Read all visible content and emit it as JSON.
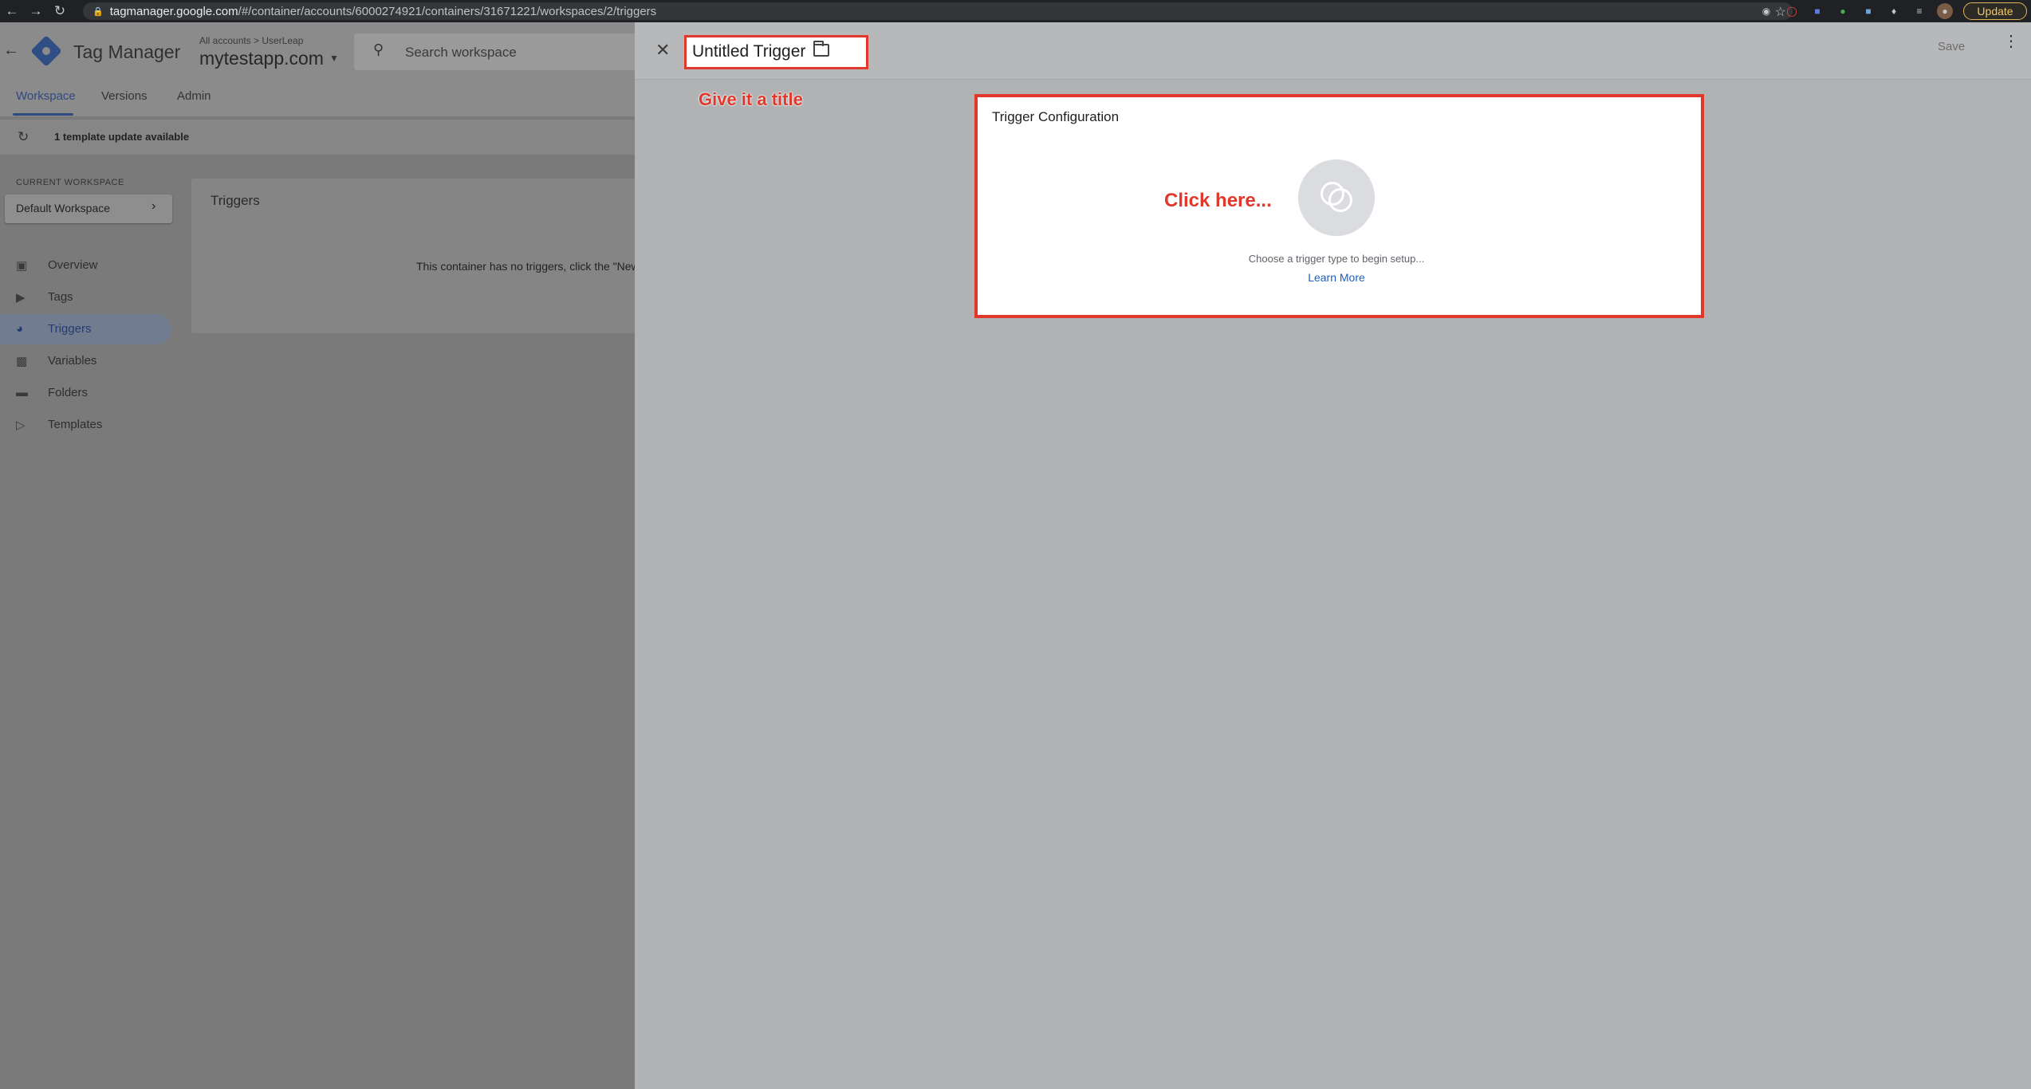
{
  "browser": {
    "url_host": "tagmanager.google.com",
    "url_path": "/#/container/accounts/6000274921/containers/31671221/workspaces/2/triggers",
    "update_label": "Update"
  },
  "app": {
    "product_name": "Tag Manager",
    "breadcrumb": "All accounts  >  UserLeap",
    "container_name": "mytestapp.com",
    "search_placeholder": "Search workspace",
    "tabs": [
      {
        "label": "Workspace"
      },
      {
        "label": "Versions"
      },
      {
        "label": "Admin"
      }
    ],
    "notice": "1 template update available",
    "current_workspace_label": "CURRENT WORKSPACE",
    "workspace_name": "Default Workspace",
    "nav": [
      {
        "label": "Overview",
        "icon": "briefcase-icon"
      },
      {
        "label": "Tags",
        "icon": "tag-icon"
      },
      {
        "label": "Triggers",
        "icon": "trigger-icon"
      },
      {
        "label": "Variables",
        "icon": "variables-icon"
      },
      {
        "label": "Folders",
        "icon": "folder-icon"
      },
      {
        "label": "Templates",
        "icon": "template-icon"
      }
    ],
    "triggers_card_title": "Triggers",
    "empty_message": "This container has no triggers, click the \"New\" button to create one."
  },
  "editor": {
    "title": "Untitled Trigger",
    "save_label": "Save",
    "config_title": "Trigger Configuration",
    "setup_hint": "Choose a trigger type to begin setup...",
    "learn_more": "Learn More"
  },
  "annotations": {
    "title_hint": "Give it a title",
    "click_hint": "Click here...",
    "color": "#e0392c"
  }
}
